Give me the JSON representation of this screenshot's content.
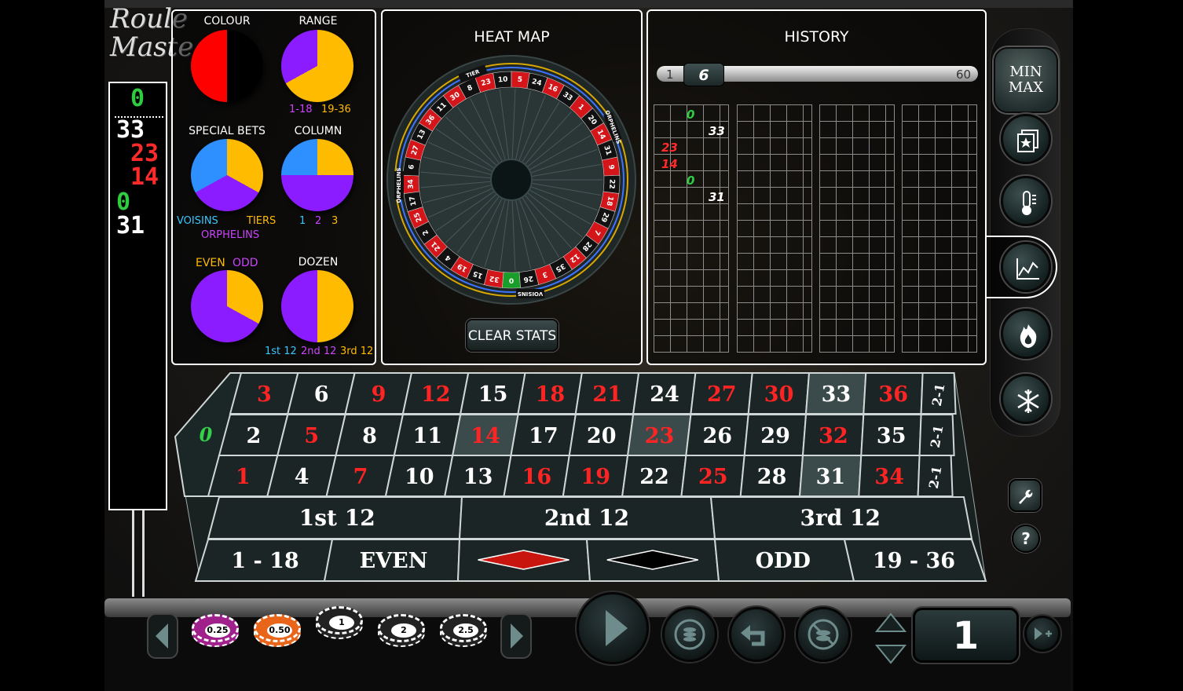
{
  "logo": {
    "line1": "Roule",
    "line2": "Maste"
  },
  "recent_numbers": [
    {
      "value": "0",
      "color": "#2ecc40"
    },
    {
      "value": "33",
      "color": "#ffffff"
    },
    {
      "value": "23",
      "color": "#ff2a2a"
    },
    {
      "value": "14",
      "color": "#ff2a2a"
    },
    {
      "value": "0",
      "color": "#2ecc40"
    },
    {
      "value": "31",
      "color": "#ffffff"
    }
  ],
  "stats": {
    "colour": {
      "title": "COLOUR",
      "split": 0.5
    },
    "range": {
      "title": "RANGE",
      "low_label": "1-18",
      "high_label": "19-36",
      "low_share": 0.33
    },
    "special_bets": {
      "title": "SPECIAL BETS",
      "voisins": "VOISINS",
      "tiers": "TIERS",
      "orphelins": "ORPHELINS"
    },
    "column": {
      "title": "COLUMN",
      "labels": [
        "1",
        "2",
        "3"
      ]
    },
    "even_odd": {
      "even": "EVEN",
      "odd": "ODD",
      "odd_share": 0.33
    },
    "dozen": {
      "title": "DOZEN",
      "labels": [
        "1st 12",
        "2nd 12",
        "3rd 12"
      ]
    },
    "colors": {
      "red": "#ff0000",
      "black": "#000000",
      "purple": "#8b1cff",
      "yellow": "#ffbb00",
      "blue": "#2e8fff",
      "cyan": "#38c7ff",
      "magenta": "#cc44ff"
    }
  },
  "heat_map": {
    "title": "HEAT MAP",
    "clear_label": "CLEAR STATS",
    "wheel_order": [
      "0",
      "32",
      "15",
      "19",
      "4",
      "21",
      "2",
      "25",
      "17",
      "34",
      "6",
      "27",
      "13",
      "36",
      "11",
      "30",
      "8",
      "23",
      "10",
      "5",
      "24",
      "16",
      "33",
      "1",
      "20",
      "14",
      "31",
      "9",
      "22",
      "18",
      "29",
      "7",
      "28",
      "12",
      "35",
      "3",
      "26"
    ],
    "red_numbers": [
      "1",
      "3",
      "5",
      "7",
      "9",
      "12",
      "14",
      "16",
      "18",
      "19",
      "21",
      "23",
      "25",
      "27",
      "30",
      "32",
      "34",
      "36"
    ],
    "sectors": {
      "tier": "TIER",
      "orphelins": "ORPHELINS",
      "voisins": "VOISINS"
    }
  },
  "history": {
    "title": "HISTORY",
    "slider_min": "1",
    "slider_max": "60",
    "slider_value": "6",
    "entries": [
      {
        "value": "0",
        "color": "#2ecc40"
      },
      {
        "value": "33",
        "color": "#ffffff"
      },
      {
        "value": "23",
        "color": "#ff2a2a"
      },
      {
        "value": "14",
        "color": "#ff2a2a"
      },
      {
        "value": "0",
        "color": "#2ecc40"
      },
      {
        "value": "31",
        "color": "#ffffff"
      }
    ]
  },
  "side_buttons": {
    "minmax_line1": "MIN",
    "minmax_line2": "MAX",
    "help": "?"
  },
  "table": {
    "zero": "0",
    "rows": [
      [
        "3",
        "6",
        "9",
        "12",
        "15",
        "18",
        "21",
        "24",
        "27",
        "30",
        "33",
        "36"
      ],
      [
        "2",
        "5",
        "8",
        "11",
        "14",
        "17",
        "20",
        "23",
        "26",
        "29",
        "32",
        "35"
      ],
      [
        "1",
        "4",
        "7",
        "10",
        "13",
        "16",
        "19",
        "22",
        "25",
        "28",
        "31",
        "34"
      ]
    ],
    "column_bets": [
      "2-1",
      "2-1",
      "2-1"
    ],
    "dozens": [
      "1st 12",
      "2nd 12",
      "3rd 12"
    ],
    "outside": [
      "1 - 18",
      "EVEN",
      "RED",
      "BLACK",
      "ODD",
      "19 - 36"
    ],
    "highlighted": [
      "33",
      "14",
      "23",
      "31"
    ],
    "red_numbers": [
      "1",
      "3",
      "5",
      "7",
      "9",
      "12",
      "14",
      "16",
      "18",
      "19",
      "21",
      "23",
      "25",
      "27",
      "30",
      "32",
      "34",
      "36"
    ]
  },
  "chips": [
    {
      "label": "0.25",
      "color": "#a0208c"
    },
    {
      "label": "0.50",
      "color": "#e8651a"
    },
    {
      "label": "1",
      "color": "#222222"
    },
    {
      "label": "2",
      "color": "#222222"
    },
    {
      "label": "2.5",
      "color": "#222222"
    }
  ],
  "bet": {
    "value": "1"
  }
}
